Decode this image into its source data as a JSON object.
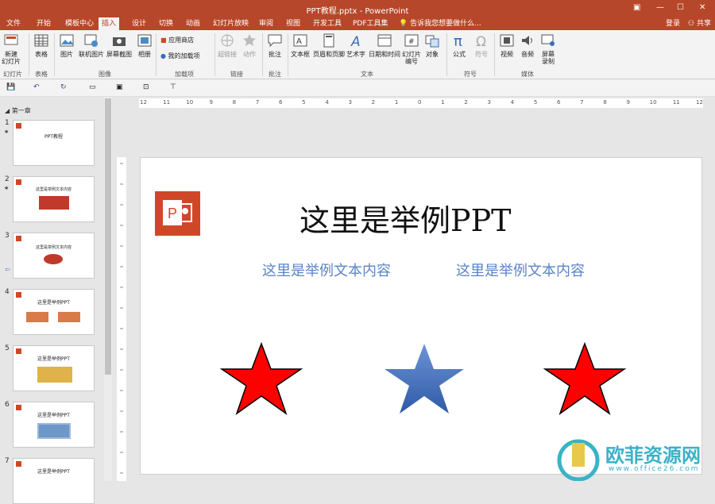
{
  "window": {
    "title": "PPT教程.pptx - PowerPoint",
    "login": "登录",
    "share": "共享"
  },
  "tabs": [
    "文件",
    "开始",
    "模板中心",
    "插入",
    "设计",
    "切换",
    "动画",
    "幻灯片放映",
    "审阅",
    "视图",
    "开发工具",
    "PDF工具集"
  ],
  "tab_active": "插入",
  "search_placeholder": "告诉我您想要做什么...",
  "ribbon": {
    "new_slide": "新建\n幻灯片",
    "table": "表格",
    "picture": "图片",
    "online_picture": "联机图片",
    "screenshot": "屏幕截图",
    "album": "相册",
    "app_store": "应用商店",
    "my_addins": "我的加载项",
    "hyperlink": "超链接",
    "action": "动作",
    "comment": "批注",
    "textbox": "文本框",
    "header_footer": "页眉和页脚",
    "wordart": "艺术字",
    "datetime": "日期和时间",
    "slide_number": "幻灯片\n编号",
    "object": "对象",
    "equation": "公式",
    "symbol": "符号",
    "video": "视频",
    "audio": "音频",
    "screen_record": "屏幕\n录制",
    "groups": {
      "slides": "幻灯片",
      "tables": "表格",
      "images": "图像",
      "addins": "加载项",
      "links": "链接",
      "comments": "批注",
      "text": "文本",
      "symbols": "符号",
      "media": "媒体"
    }
  },
  "panel": {
    "section": "第一章",
    "slides": [
      {
        "num": "1",
        "star": true,
        "text": "PPT教程"
      },
      {
        "num": "2",
        "star": true,
        "text": "这里是举例文本内容"
      },
      {
        "num": "3",
        "star": false,
        "text": "这里是举例文本内容"
      },
      {
        "num": "4",
        "star": false,
        "text": "这里是举例PPT"
      },
      {
        "num": "5",
        "star": false,
        "text": "这里是举例PPT"
      },
      {
        "num": "6",
        "star": false,
        "text": "这里是举例PPT"
      },
      {
        "num": "7",
        "star": false,
        "text": "这里是举例PPT"
      }
    ]
  },
  "ruler_labels": [
    "12",
    "11",
    "10",
    "9",
    "8",
    "7",
    "6",
    "5",
    "4",
    "3",
    "2",
    "1",
    "0",
    "1",
    "2",
    "3",
    "4",
    "5",
    "6",
    "7",
    "8",
    "9",
    "10",
    "11",
    "12"
  ],
  "slide": {
    "title": "这里是举例PPT",
    "subtitle_left": "这里是举例文本内容",
    "subtitle_right": "这里是举例文本内容"
  },
  "watermark": {
    "name": "欧菲资源网",
    "url": "www.office26.com"
  },
  "colors": {
    "accent": "#b7472a",
    "star_red": "#ff0000",
    "star_blue": "#4a72b8",
    "subtitle": "#5b84c5"
  }
}
